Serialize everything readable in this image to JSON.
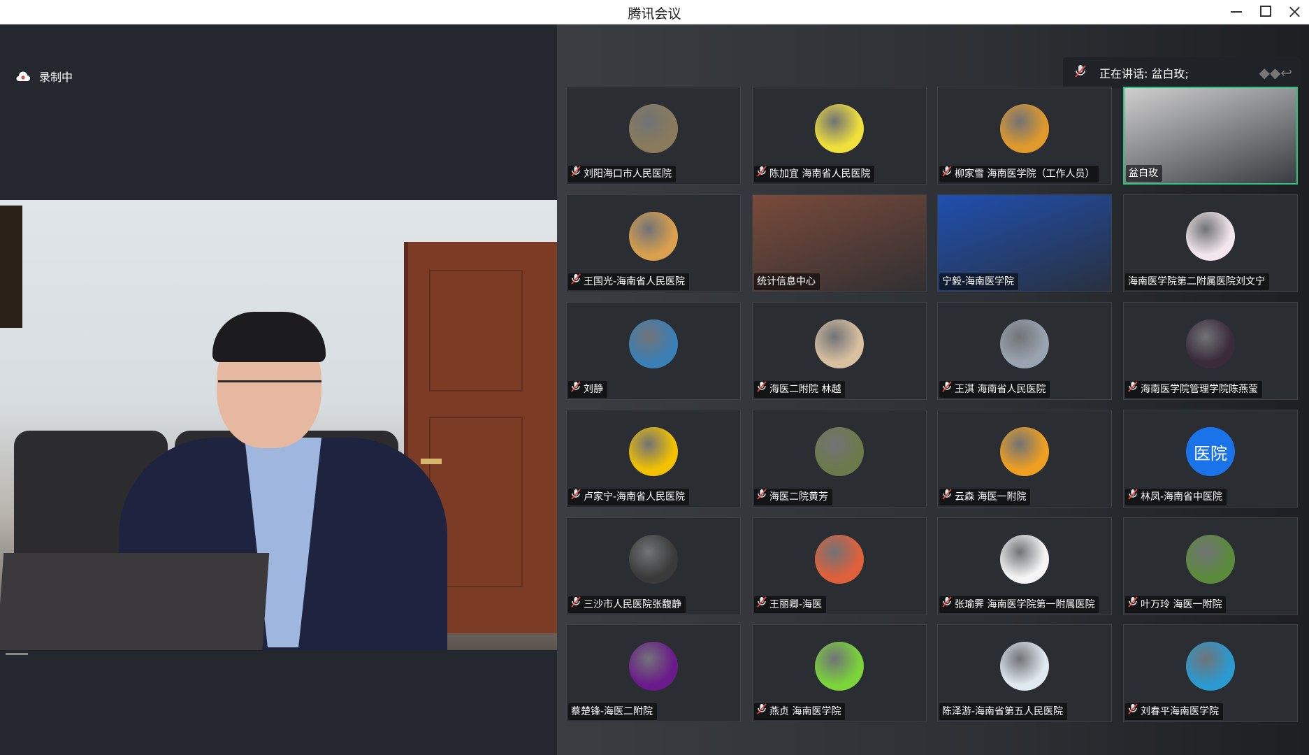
{
  "window": {
    "title": "腾讯会议"
  },
  "recording": {
    "label": "录制中"
  },
  "speaking": {
    "label": "正在讲话: 盆白玫;"
  },
  "participants": [
    {
      "name": "刘阳海口市人民医院",
      "muted": true,
      "avatar": "landscape",
      "color": "#8a7a5c"
    },
    {
      "name": "陈加宜 海南省人民医院",
      "muted": true,
      "avatar": "yellow-cartoon",
      "color": "#f0e03a"
    },
    {
      "name": "柳家雪 海南医学院（工作人员）",
      "muted": true,
      "avatar": "orange-figure",
      "color": "#e09a2b"
    },
    {
      "name": "盆白玫",
      "muted": false,
      "avatar": "video",
      "color": "#cfcfcf"
    },
    {
      "name": "王国光-海南省人民医院",
      "muted": true,
      "avatar": "anime",
      "color": "#d9a04d"
    },
    {
      "name": "统计信息中心",
      "muted": false,
      "avatar": "video",
      "color": "#7a4a3a"
    },
    {
      "name": "宁毅-海南医学院",
      "muted": false,
      "avatar": "video",
      "color": "#1f4fb0"
    },
    {
      "name": "海南医学院第二附属医院刘文宁",
      "muted": false,
      "avatar": "pink-dino",
      "color": "#f3e6ec"
    },
    {
      "name": "刘静",
      "muted": true,
      "avatar": "beach",
      "color": "#3a7fb5"
    },
    {
      "name": "海医二附院 林越",
      "muted": true,
      "avatar": "girl-cartoon",
      "color": "#d9c0a0"
    },
    {
      "name": "王淇 海南省人民医院",
      "muted": true,
      "avatar": "photo",
      "color": "#9aa3b0"
    },
    {
      "name": "海南医学院管理学院陈燕莹",
      "muted": true,
      "avatar": "dark-figure",
      "color": "#3a2a3a"
    },
    {
      "name": "卢家宁-海南省人民医院",
      "muted": true,
      "avatar": "silhouette",
      "color": "#f2c200"
    },
    {
      "name": "海医二院黄芳",
      "muted": true,
      "avatar": "forest",
      "color": "#6b7a4a"
    },
    {
      "name": "云森 海医一附院",
      "muted": true,
      "avatar": "sunset",
      "color": "#f0a020"
    },
    {
      "name": "林凤-海南省中医院",
      "muted": true,
      "avatar": "text",
      "avatar_text": "医院",
      "color": "#1a73e8"
    },
    {
      "name": "三沙市人民医院张馥静",
      "muted": true,
      "avatar": "portrait",
      "color": "#3a3a3a"
    },
    {
      "name": "王丽卿-海医",
      "muted": true,
      "avatar": "blocks",
      "color": "#e0603a"
    },
    {
      "name": "张瑜霁 海南医学院第一附属医院",
      "muted": true,
      "avatar": "white-ghost",
      "color": "#f5f5f5"
    },
    {
      "name": "叶万玲 海医一附院",
      "muted": true,
      "avatar": "green-leaf",
      "color": "#5a8a3a"
    },
    {
      "name": "蔡楚锋-海医二附院",
      "muted": false,
      "avatar": "purple-glow",
      "color": "#6a1a8a"
    },
    {
      "name": "燕贞 海南医学院",
      "muted": true,
      "avatar": "clover",
      "color": "#7ad43a"
    },
    {
      "name": "陈泽游-海南省第五人民医院",
      "muted": false,
      "avatar": "boy-cartoon",
      "color": "#e0e8f0"
    },
    {
      "name": "刘春平海南医学院",
      "muted": true,
      "avatar": "palm",
      "color": "#2a9ad0"
    }
  ]
}
